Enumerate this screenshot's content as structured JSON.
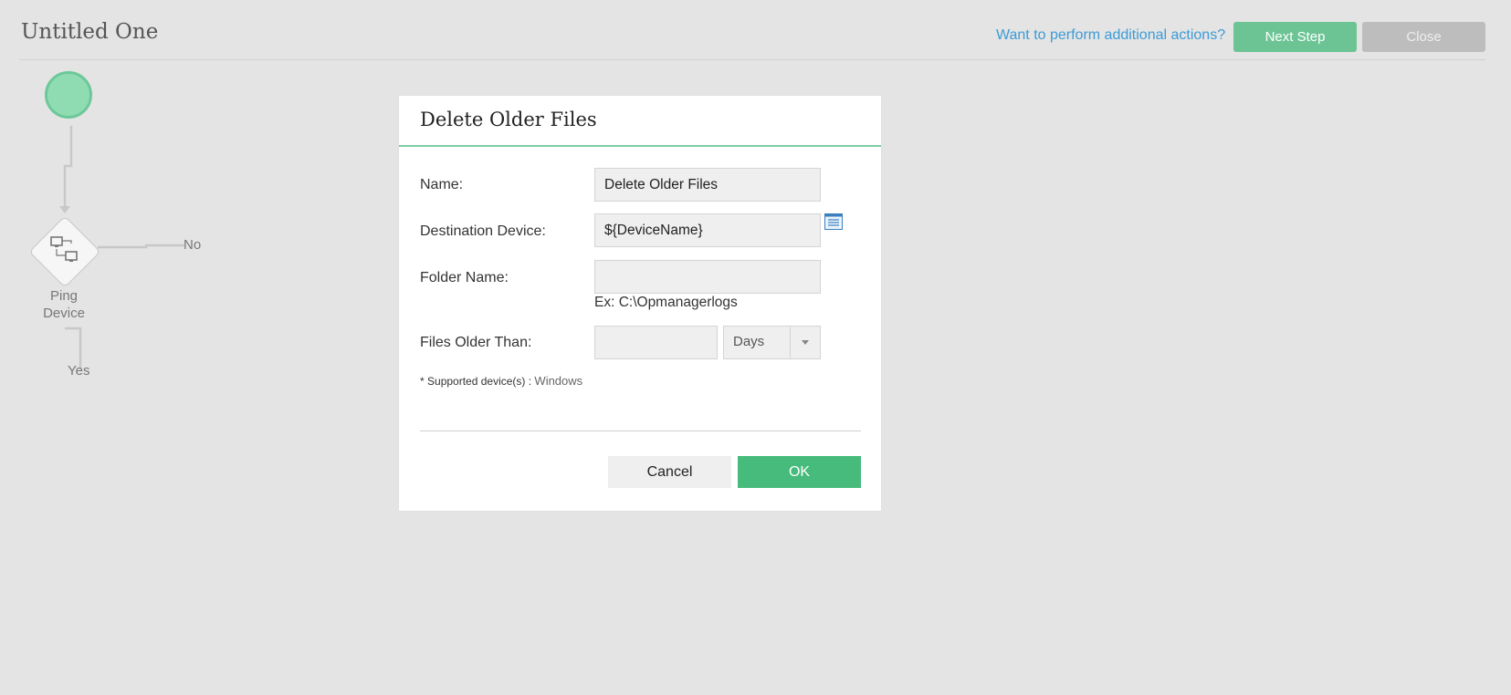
{
  "header": {
    "title": "Untitled One",
    "link_text": "Want to perform additional actions?",
    "next_step_label": "Next Step",
    "close_label": "Close"
  },
  "workflow": {
    "ping_node_label_line1": "Ping",
    "ping_node_label_line2": "Device",
    "no_branch_label": "No",
    "yes_branch_label": "Yes"
  },
  "dialog": {
    "title": "Delete Older Files",
    "fields": {
      "name_label": "Name:",
      "name_value": "Delete Older Files",
      "destination_label": "Destination Device:",
      "destination_value": "${DeviceName}",
      "folder_label": "Folder Name:",
      "folder_value": "",
      "folder_hint": "Ex: C:\\Opmanagerlogs",
      "files_older_label": "Files Older Than:",
      "files_older_value": "",
      "unit_selected": "Days"
    },
    "supported_prefix": "* ",
    "supported_label": "Supported device(s) : ",
    "supported_value": "Windows",
    "cancel_label": "Cancel",
    "ok_label": "OK"
  },
  "colors": {
    "accent_green": "#46bb7b",
    "link_blue": "#3c9bd6",
    "start_node_green": "#8fdcb2"
  },
  "icons": {
    "browse": "list-icon",
    "ping": "network-devices-icon",
    "select_arrow": "chevron-down-icon"
  }
}
